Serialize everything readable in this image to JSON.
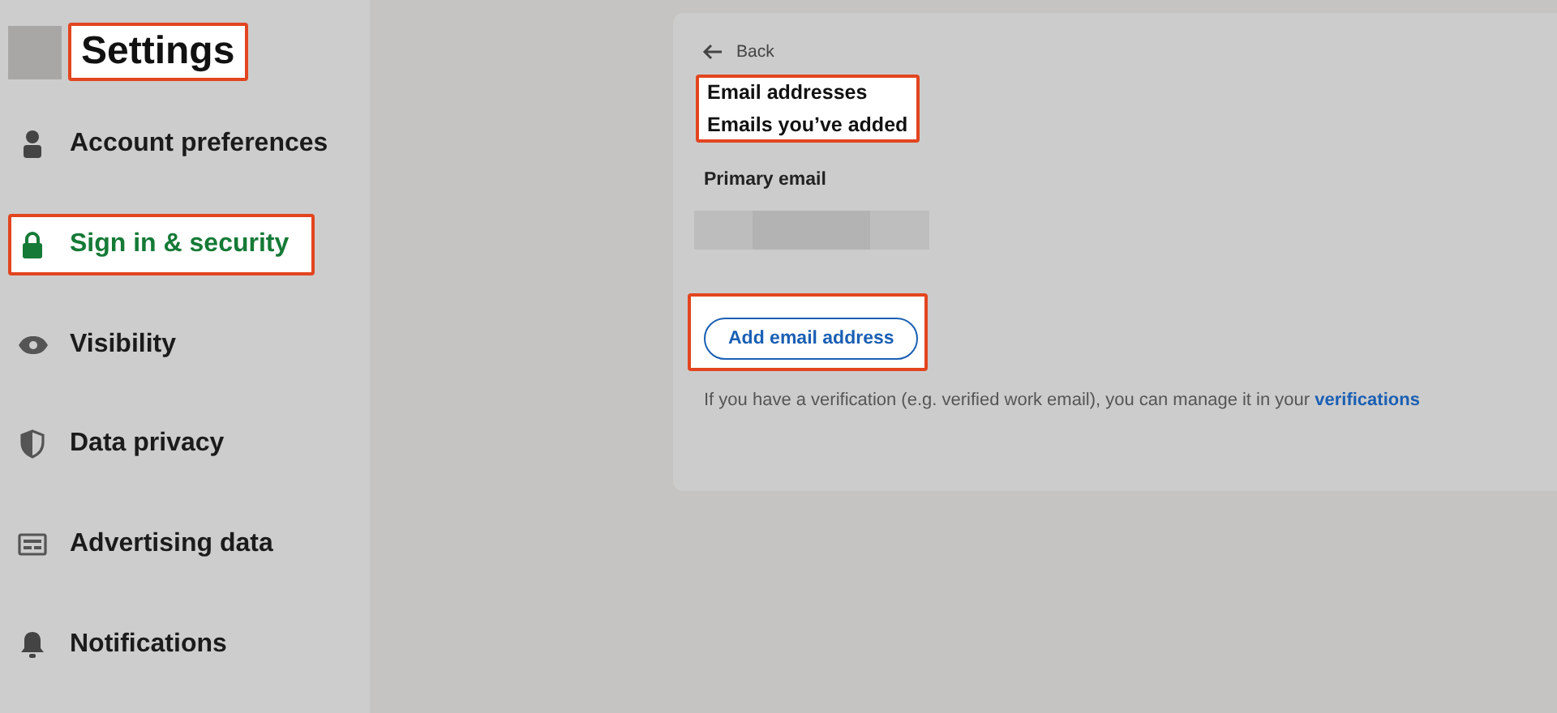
{
  "header": {
    "title": "Settings",
    "highlighted": true
  },
  "sidebar": {
    "items": [
      {
        "kind": "person",
        "label": "Account preferences",
        "selected": false,
        "highlighted": false
      },
      {
        "kind": "lock",
        "label": "Sign in & security",
        "selected": true,
        "highlighted": true
      },
      {
        "kind": "eye",
        "label": "Visibility",
        "selected": false,
        "highlighted": false
      },
      {
        "kind": "shield",
        "label": "Data privacy",
        "selected": false,
        "highlighted": false
      },
      {
        "kind": "card",
        "label": "Advertising data",
        "selected": false,
        "highlighted": false
      },
      {
        "kind": "bell",
        "label": "Notifications",
        "selected": false,
        "highlighted": false
      }
    ]
  },
  "panel": {
    "back": "Back",
    "heading": {
      "title": "Email addresses",
      "subtitle": "Emails you’ve added",
      "highlighted": true
    },
    "primary_label": "Primary email",
    "add_button": {
      "label": "Add email address",
      "highlighted": true
    },
    "note": {
      "text": "If you have a verification (e.g. verified work email), you can manage it in your",
      "link": "verifications"
    }
  }
}
